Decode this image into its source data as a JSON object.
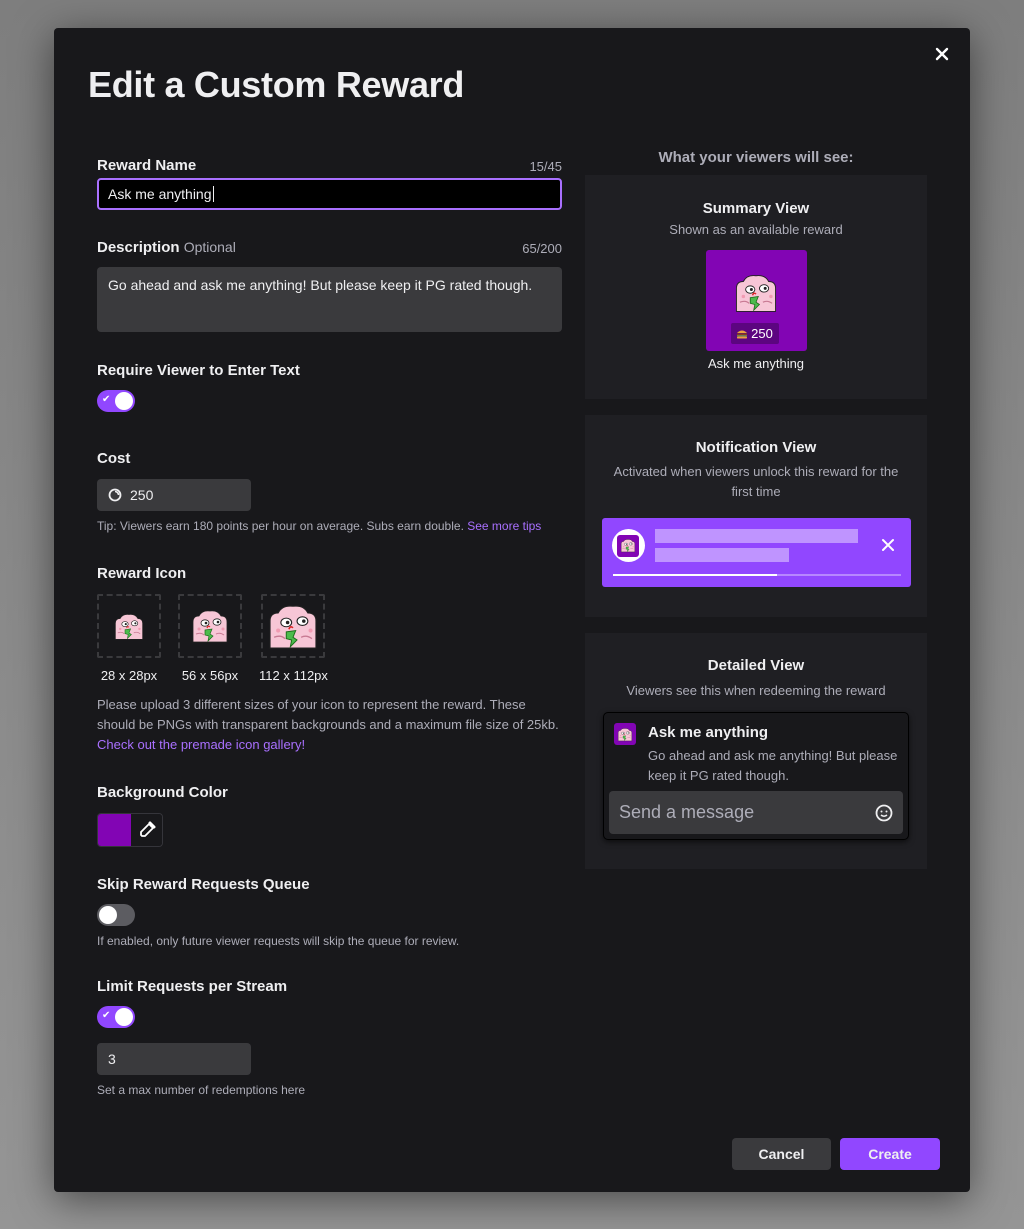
{
  "modal": {
    "title": "Edit a Custom Reward",
    "close_icon": "close-icon"
  },
  "form": {
    "reward_name": {
      "label": "Reward Name",
      "counter": "15/45",
      "value": "Ask me anything"
    },
    "description": {
      "label": "Description",
      "optional_label": "Optional",
      "counter": "65/200",
      "value": "Go ahead and ask me anything! But please keep it PG rated though."
    },
    "require_text": {
      "label": "Require Viewer to Enter Text",
      "enabled": true
    },
    "cost": {
      "label": "Cost",
      "icon": "channel-points-icon",
      "value": "250",
      "tip": "Tip: Viewers earn 180 points per hour on average. Subs earn double.",
      "tip_link": "See more tips"
    },
    "reward_icon": {
      "label": "Reward Icon",
      "sizes": [
        "28 x 28px",
        "56 x 56px",
        "112 x 112px"
      ],
      "help": "Please upload 3 different sizes of your icon to represent the reward. These should be PNGs with transparent backgrounds and a maximum file size of 25kb.",
      "help_link": "Check out the premade icon gallery!"
    },
    "background_color": {
      "label": "Background Color",
      "value": "#8205B4",
      "picker_icon": "eyedropper-icon"
    },
    "skip_queue": {
      "label": "Skip Reward Requests Queue",
      "enabled": false,
      "hint": "If enabled, only future viewer requests will skip the queue for review."
    },
    "limit_per_stream": {
      "label": "Limit Requests per Stream",
      "enabled": true,
      "value": "3",
      "hint": "Set a max number of redemptions here"
    }
  },
  "preview": {
    "heading": "What your viewers will see:",
    "summary": {
      "title": "Summary View",
      "subtitle": "Shown as an available reward",
      "cost": "250",
      "cost_icon": "burger-icon",
      "name": "Ask me anything"
    },
    "notification": {
      "title": "Notification View",
      "subtitle": "Activated when viewers unlock this reward for the first time",
      "progress": 0.57,
      "close_icon": "close-icon"
    },
    "detailed": {
      "title": "Detailed View",
      "subtitle": "Viewers see this when redeeming the reward",
      "reward_name": "Ask me anything",
      "reward_description": "Go ahead and ask me anything! But please keep it PG rated though.",
      "message_placeholder": "Send a message",
      "emote_icon": "smiley-icon"
    }
  },
  "footer": {
    "cancel_label": "Cancel",
    "create_label": "Create"
  },
  "colors": {
    "accent": "#9147FF",
    "link": "#A970FF",
    "reward_bg": "#8205B4",
    "modal_bg": "#18181B",
    "panel_bg": "#1F1F23"
  }
}
